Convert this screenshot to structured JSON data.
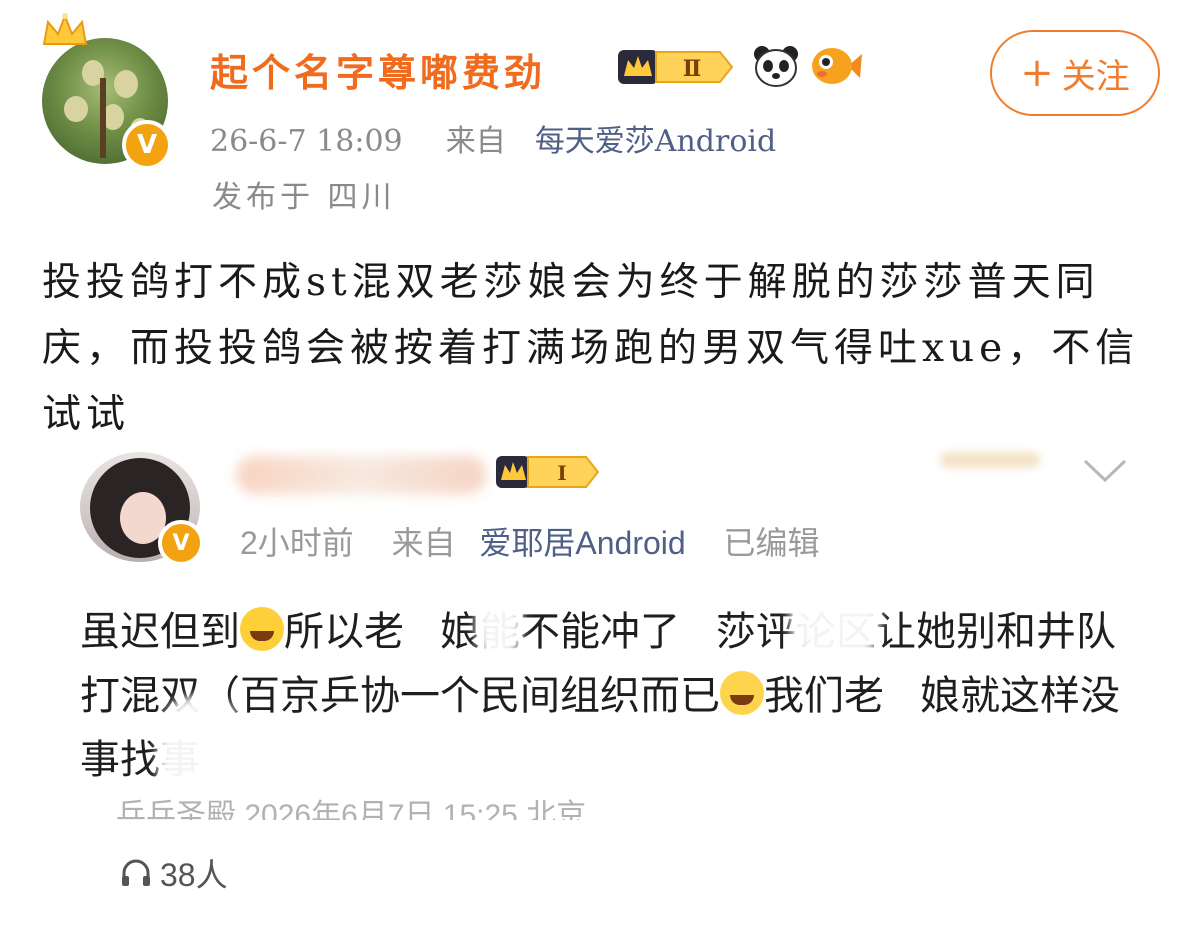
{
  "post": {
    "username": "起个名字尊嘟费劲",
    "level_badge": "Ⅱ",
    "timestamp": "26-6-7 18:09",
    "source_prefix": "来自",
    "source_app": "每天爱莎Android",
    "location": "发布于 四川",
    "follow_label": "关注",
    "follow_icon": "+",
    "content": "投投鸽打不成st混双老莎娘会为终于解脱的莎莎普天同庆，而投投鸽会被按着打满场跑的男双气得吐xue，不信试试"
  },
  "quoted": {
    "level_badge": "Ⅰ",
    "time": "2小时前",
    "source_prefix": "来自",
    "source_app": "爱耶居Android",
    "edited": "已编辑",
    "content_a": "虽迟但到",
    "content_b": "所以老",
    "content_c": "娘能不能冲了",
    "content_d": "莎评论区让她别和井队打混双（百京乒协一个民间组织而已",
    "content_e": "我们老",
    "content_f": "娘就这样没事找事",
    "cutoff_line": "乒乓圣殿  2026年6月7日 15:25  北京",
    "listeners": "38人"
  },
  "colors": {
    "accent": "#f06b1d",
    "link": "#4f5f86",
    "muted": "#8a8a8a",
    "vip": "#f2a30f"
  },
  "icons": [
    "crown-icon",
    "verified-v-icon",
    "level-badge-icon",
    "panda-icon",
    "fish-icon",
    "chevron-down-icon",
    "headphones-icon",
    "laugh-cry-emoji",
    "crying-emoji"
  ]
}
